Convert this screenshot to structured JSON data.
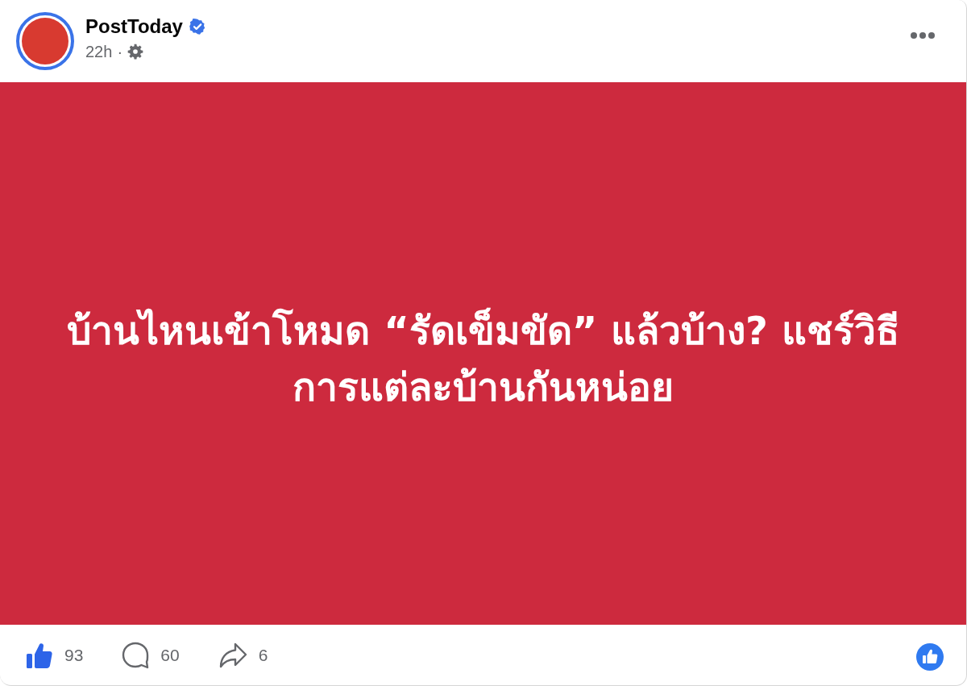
{
  "post": {
    "page_name": "PostToday",
    "verified": true,
    "time": "22h",
    "separator": "·",
    "text": "บ้านไหนเข้าโหมด “รัดเข็มขัด” แล้วบ้าง? แชร์วิธีการแต่ละบ้านกันหน่อย",
    "counts": {
      "likes": "93",
      "comments": "60",
      "shares": "6"
    }
  }
}
